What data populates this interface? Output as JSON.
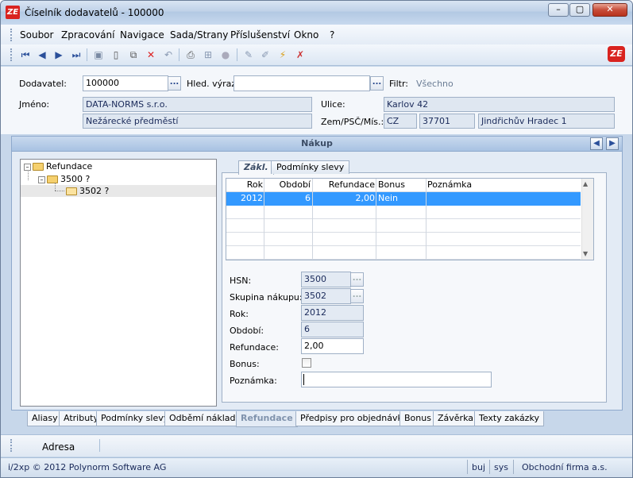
{
  "window": {
    "title": "Číselník dodavatelů - 100000",
    "logo": "ZE",
    "min": "–",
    "max": "▢",
    "close": "✕"
  },
  "menu": [
    "Soubor",
    "Zpracování",
    "Navigace",
    "Sada/Strany",
    "Příslušenství",
    "Okno",
    "?"
  ],
  "toolbar": {
    "icons": [
      "first-icon",
      "prev-icon",
      "next-icon",
      "last-icon",
      "save-icon",
      "new-icon",
      "copy-icon",
      "delete-icon",
      "undo-icon",
      "print-icon",
      "tree-icon",
      "disabled-icon",
      "edit-icon",
      "edit2-icon",
      "lightning-icon",
      "filter-clear-icon"
    ],
    "logo": "ZE"
  },
  "form": {
    "dodavatel_label": "Dodavatel:",
    "dodavatel_value": "100000",
    "dots": "...",
    "hled_label": "Hled. výraz:",
    "hled_value": "",
    "filtr_label": "Filtr:",
    "filtr_value": "Všechno",
    "jmeno_label": "Jméno:",
    "jmeno_line1": "DATA-NORMS s.r.o.",
    "jmeno_line2": "Nežárecké předměstí",
    "ulice_label": "Ulice:",
    "ulice_value": "Karlov 42",
    "zem_label": "Zem/PSČ/Mís.:",
    "zem_value": "CZ",
    "psc_value": "37701",
    "misto_value": "Jindřichův Hradec 1"
  },
  "section": {
    "title": "Nákup",
    "nav_prev": "◀",
    "nav_next": "▶"
  },
  "tree": [
    {
      "label": "Refundace",
      "toggle": "–",
      "level": 0
    },
    {
      "label": "3500 ?",
      "toggle": "–",
      "level": 1
    },
    {
      "label": "3502 ?",
      "toggle": "",
      "level": 2
    }
  ],
  "tabs": [
    "Zákl.",
    "Podmínky slevy"
  ],
  "grid": {
    "headers": [
      "Rok",
      "Období",
      "Refundace",
      "Bonus",
      "Poznámka"
    ],
    "rows": [
      [
        "2012",
        "6",
        "2,00",
        "Nein",
        ""
      ]
    ]
  },
  "details": {
    "hsn_label": "HSN:",
    "hsn_value": "3500",
    "skupina_label": "Skupina nákupu:",
    "skupina_value": "3502",
    "rok_label": "Rok:",
    "rok_value": "2012",
    "obdobi_label": "Období:",
    "obdobi_value": "6",
    "refundace_label": "Refundace:",
    "refundace_value": "2,00",
    "bonus_label": "Bonus:",
    "bonus_checked": false,
    "poznamka_label": "Poznámka:",
    "poznamka_value": ""
  },
  "bottom_tabs": [
    "Aliasy",
    "Atributy",
    "Podmínky slevy",
    "Odběmí náklady",
    "Refundace",
    "Předpisy pro objednávku",
    "Bonus",
    "Závěrka",
    "Texty zakázky"
  ],
  "active_bottom_tab": "Refundace",
  "adresa": "Adresa",
  "status": {
    "copyright": "i/2xp © 2012 Polynorm Software AG",
    "user": "buj",
    "sys": "sys",
    "company": "Obchodní firma a.s."
  }
}
